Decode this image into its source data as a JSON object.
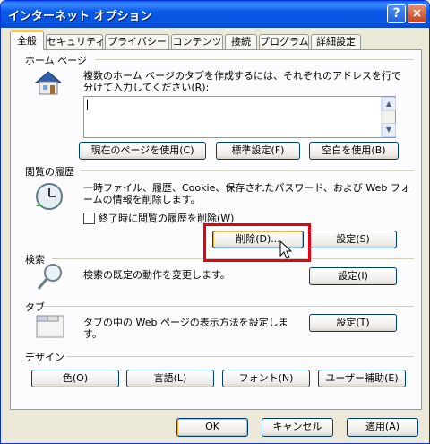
{
  "window": {
    "title": "インターネット オプション",
    "help_label": "?",
    "close_label": "×"
  },
  "tabs": [
    {
      "label": "全般",
      "active": true
    },
    {
      "label": "セキュリティ"
    },
    {
      "label": "プライバシー"
    },
    {
      "label": "コンテンツ"
    },
    {
      "label": "接続"
    },
    {
      "label": "プログラム"
    },
    {
      "label": "詳細設定"
    }
  ],
  "home_page": {
    "group_label": "ホーム ページ",
    "description": "複数のホーム ページのタブを作成するには、それぞれのアドレスを行で分けて入力してください(R):",
    "url_value": "",
    "buttons": {
      "current": "現在のページを使用(C)",
      "default": "標準設定(F)",
      "blank": "空白を使用(B)"
    }
  },
  "history": {
    "group_label": "閲覧の履歴",
    "description": "一時ファイル、履歴、Cookie、保存されたパスワード、および Web フォームの情報を削除します。",
    "checkbox_label": "終了時に閲覧の履歴を削除(W)",
    "checkbox_checked": false,
    "delete_button": "削除(D)...",
    "settings_button": "設定(S)"
  },
  "search": {
    "group_label": "検索",
    "description": "検索の既定の動作を変更します。",
    "settings_button": "設定(I)"
  },
  "tabs_section": {
    "group_label": "タブ",
    "description": "タブの中の Web ページの表示方法を設定します。",
    "settings_button": "設定(T)"
  },
  "design": {
    "group_label": "デザイン",
    "buttons": {
      "colors": "色(O)",
      "languages": "言語(L)",
      "fonts": "フォント(N)",
      "accessibility": "ユーザー補助(E)"
    }
  },
  "dialog_buttons": {
    "ok": "OK",
    "cancel": "キャンセル",
    "apply": "適用(A)"
  },
  "colors": {
    "titlebar": "#0A58E6",
    "highlight": "#E60012",
    "dialog_bg": "#ECE9D8"
  }
}
